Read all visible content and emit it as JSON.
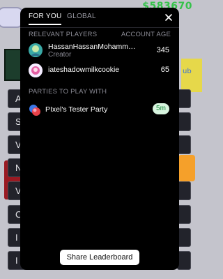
{
  "background": {
    "money": "$583670",
    "yellow_text": "ub",
    "left_tiles": [
      "A",
      "S",
      "V",
      "N",
      "V",
      "C",
      "I",
      "I"
    ]
  },
  "panel": {
    "tabs": [
      {
        "label": "FOR YOU",
        "active": true
      },
      {
        "label": "GLOBAL",
        "active": false
      }
    ],
    "close_icon": "close-x",
    "relevant_header": "RELEVANT PLAYERS",
    "account_age_header": "ACCOUNT AGE",
    "players": [
      {
        "name": "HassanHassanMohamm…",
        "subtitle": "Creator",
        "age": "345",
        "avatar_color": "#3aa9a6"
      },
      {
        "name": "iateshadowmilkcookie",
        "subtitle": "",
        "age": "65",
        "avatar_color": "#f0e6ff"
      }
    ],
    "parties_header": "PARTIES TO PLAY WITH",
    "parties": [
      {
        "name": "PIxel's Tester Party",
        "badge": "5m"
      }
    ],
    "share_button": "Share Leaderboard"
  },
  "colors": {
    "panel_bg": "#000000",
    "badge_bg": "#d8f5df",
    "badge_text": "#168a3a",
    "money": "#35c24a"
  }
}
